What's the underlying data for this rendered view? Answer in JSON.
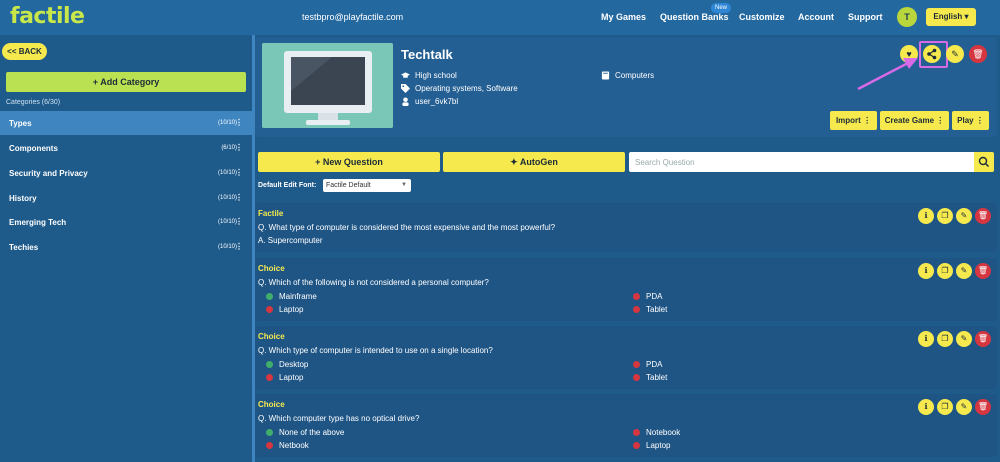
{
  "app": {
    "logo": "factile",
    "user_email": "testbpro@playfactile.com"
  },
  "nav": {
    "items": [
      "My Games",
      "Question Banks",
      "Customize",
      "Account",
      "Support"
    ],
    "badge": "New",
    "avatar_letter": "T",
    "language": "English"
  },
  "sidebar": {
    "back_label": "<< BACK",
    "add_category_label": "+ Add Category",
    "categories_count": "Categories (6/30)",
    "categories": [
      {
        "name": "Types",
        "count": "(10/10)"
      },
      {
        "name": "Components",
        "count": "(6/10)"
      },
      {
        "name": "Security and Privacy",
        "count": "(10/10)"
      },
      {
        "name": "History",
        "count": "(10/10)"
      },
      {
        "name": "Emerging Tech",
        "count": "(10/10)"
      },
      {
        "name": "Techies",
        "count": "(10/10)"
      }
    ]
  },
  "game": {
    "title": "Techtalk",
    "level": "High school",
    "tags": "Operating systems, Software",
    "author": "user_6vk7bl",
    "subject": "Computers",
    "actions": {
      "import": "Import",
      "create_game": "Create Game",
      "play": "Play"
    }
  },
  "toolbar": {
    "new_question": "+ New Question",
    "autogen": "AutoGen",
    "search_placeholder": "Search Question",
    "font_label": "Default Edit Font:",
    "font_value": "Factile Default"
  },
  "questions": [
    {
      "type": "Factile",
      "text": "Q. What type of computer is considered the most expensive and the most powerful?",
      "answer": "A. Supercomputer"
    },
    {
      "type": "Choice",
      "text": "Q. Which of the following is not considered a personal computer?",
      "options": [
        {
          "label": "Mainframe",
          "correct": true
        },
        {
          "label": "PDA",
          "correct": false
        },
        {
          "label": "Laptop",
          "correct": false
        },
        {
          "label": "Tablet",
          "correct": false
        }
      ]
    },
    {
      "type": "Choice",
      "text": "Q. Which type of computer is intended to use on a single location?",
      "options": [
        {
          "label": "Desktop",
          "correct": true
        },
        {
          "label": "PDA",
          "correct": false
        },
        {
          "label": "Laptop",
          "correct": false
        },
        {
          "label": "Tablet",
          "correct": false
        }
      ]
    },
    {
      "type": "Choice",
      "text": "Q. Which computer type has no optical drive?",
      "options": [
        {
          "label": "None of the above",
          "correct": true
        },
        {
          "label": "Notebook",
          "correct": false
        },
        {
          "label": "Netbook",
          "correct": false
        },
        {
          "label": "Laptop",
          "correct": false
        }
      ]
    }
  ],
  "colors": {
    "accent_yellow": "#f5e94d",
    "accent_green": "#b9e151",
    "danger": "#d6363f",
    "highlight": "#d86ae8"
  }
}
